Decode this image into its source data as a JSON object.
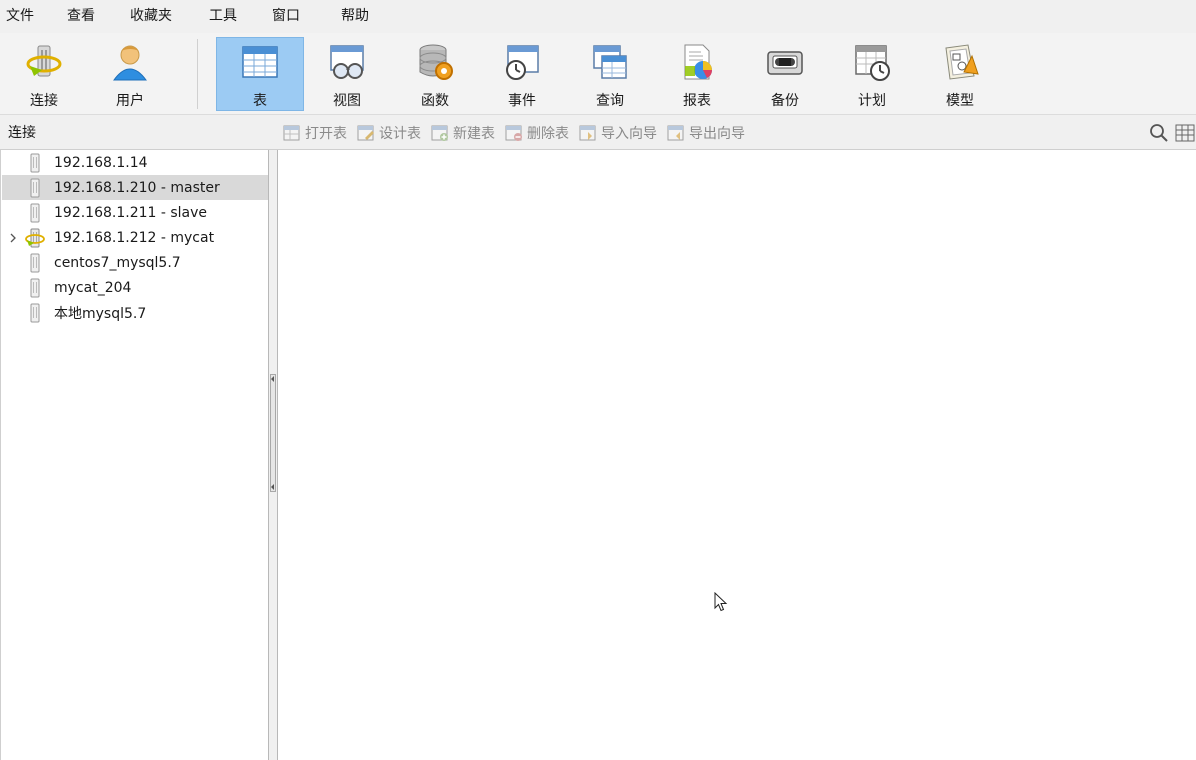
{
  "menubar": {
    "items": [
      {
        "label": "文件"
      },
      {
        "label": "查看"
      },
      {
        "label": "收藏夹"
      },
      {
        "label": "工具"
      },
      {
        "label": "窗口"
      },
      {
        "label": "帮助"
      }
    ]
  },
  "toolbar": {
    "connect_label": "连接",
    "user_label": "用户",
    "table_label": "表",
    "view_label": "视图",
    "function_label": "函数",
    "event_label": "事件",
    "query_label": "查询",
    "report_label": "报表",
    "backup_label": "备份",
    "schedule_label": "计划",
    "model_label": "模型",
    "active": "表"
  },
  "subbar": {
    "title": "连接",
    "open_table": "打开表",
    "design_table": "设计表",
    "new_table": "新建表",
    "delete_table": "删除表",
    "import_wizard": "导入向导",
    "export_wizard": "导出向导"
  },
  "connections": {
    "items": [
      {
        "label": "192.168.1.14",
        "selected": false,
        "expandable": false
      },
      {
        "label": "192.168.1.210 - master",
        "selected": true,
        "expandable": false
      },
      {
        "label": "192.168.1.211 - slave",
        "selected": false,
        "expandable": false
      },
      {
        "label": "192.168.1.212 - mycat",
        "selected": false,
        "expandable": true
      },
      {
        "label": "centos7_mysql5.7",
        "selected": false,
        "expandable": false
      },
      {
        "label": "mycat_204",
        "selected": false,
        "expandable": false
      },
      {
        "label": "本地mysql5.7",
        "selected": false,
        "expandable": false
      }
    ]
  },
  "colors": {
    "active_tool_bg": "#9ccbf3",
    "selected_row_bg": "#d9d9d9",
    "disabled_text": "#8a8a8a"
  },
  "icons": {
    "connect": "plug-connect-icon",
    "user": "user-icon",
    "table": "table-icon",
    "view": "view-glasses-icon",
    "function": "function-gear-icon",
    "event": "event-clock-icon",
    "query": "query-icon",
    "report": "report-chart-icon",
    "backup": "backup-tape-icon",
    "schedule": "schedule-calendar-icon",
    "model": "model-icon",
    "search": "search-icon",
    "grid": "grid-view-icon"
  }
}
